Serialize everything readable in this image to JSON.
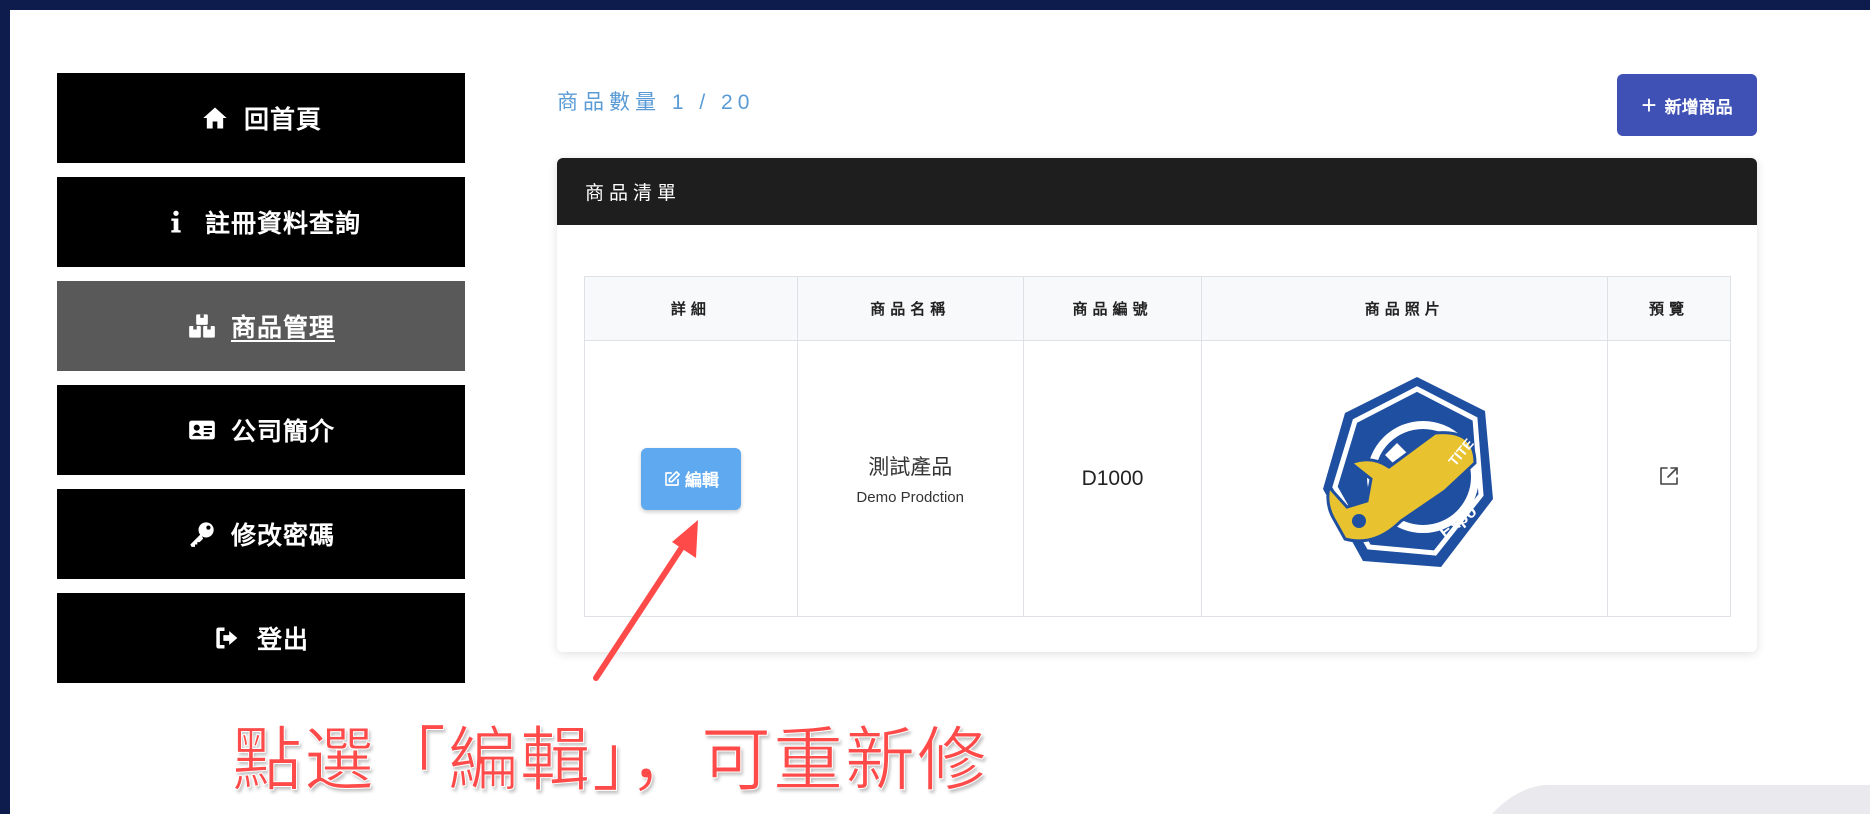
{
  "sidebar": {
    "items": [
      {
        "label": "回首頁",
        "icon": "home-icon"
      },
      {
        "label": "註冊資料查詢",
        "icon": "info-icon"
      },
      {
        "label": "商品管理",
        "icon": "boxes-icon",
        "active": true
      },
      {
        "label": "公司簡介",
        "icon": "id-card-icon"
      },
      {
        "label": "修改密碼",
        "icon": "key-icon"
      },
      {
        "label": "登出",
        "icon": "logout-icon"
      }
    ]
  },
  "main": {
    "count_text": "商品數量 1 / 20",
    "add_button": {
      "label": "新增商品",
      "icon": "plus-icon"
    },
    "card_title": "商品清單",
    "table": {
      "headers": [
        "詳細",
        "商品名稱",
        "商品編號",
        "商品照片",
        "預覽"
      ],
      "rows": [
        {
          "edit_label": "編輯",
          "name_zh": "測試產品",
          "name_en": "Demo Prodction",
          "code": "D1000",
          "photo": "wrench-logo-image",
          "preview_icon": "external-link-icon"
        }
      ]
    }
  },
  "logo": {
    "text_top": "TITE",
    "text_bottom": "Expo"
  },
  "annotation": {
    "text": "點選「編輯」，可重新修"
  },
  "colors": {
    "frame": "#0d1b4d",
    "nav_bg": "#000000",
    "nav_active_bg": "#5a5959",
    "accent_add": "#3f51b5",
    "edit_button": "#5ea9f0",
    "count_text": "#5b9bd5",
    "annotation": "#ff4a4a",
    "card_header": "#1e1e1e"
  }
}
